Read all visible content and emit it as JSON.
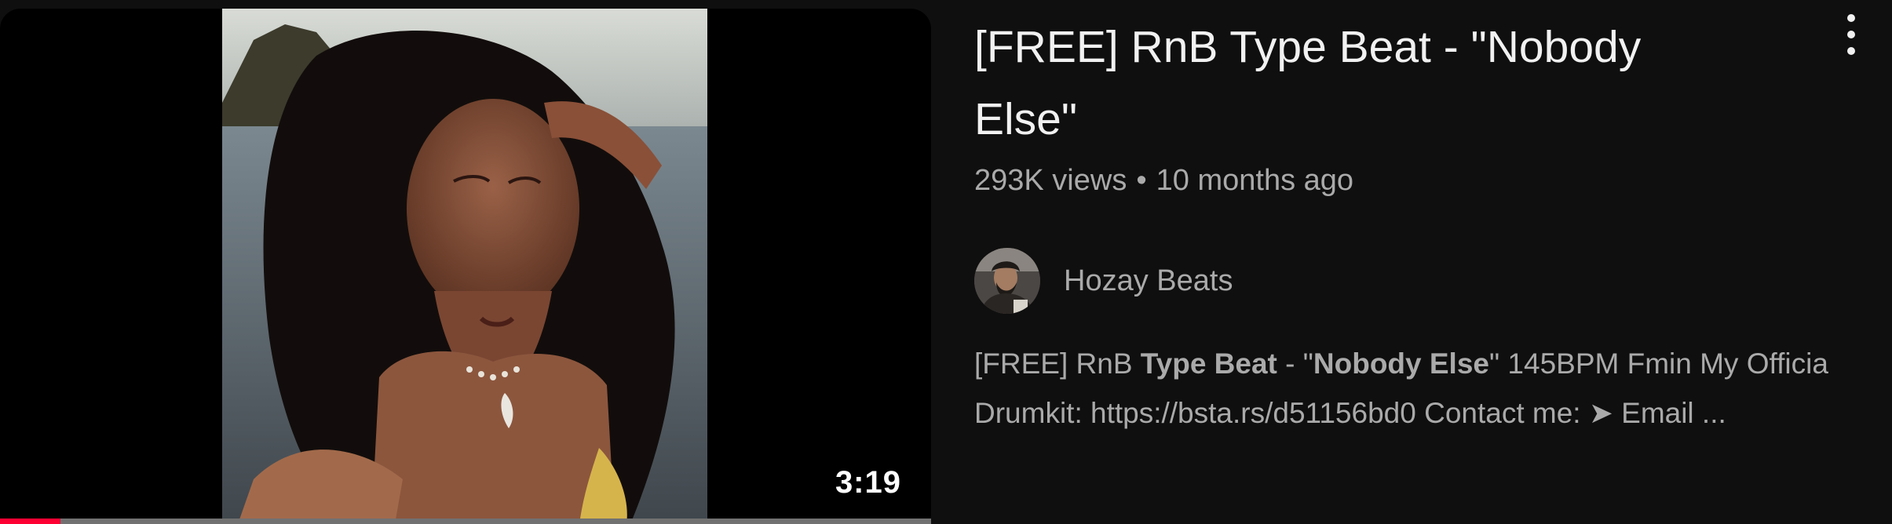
{
  "video": {
    "title": "[FREE] RnB Type Beat - \"Nobody Else\"",
    "views": "293K views",
    "separator": "•",
    "age": "10 months ago",
    "duration": "3:19",
    "watch_progress": 0.065,
    "channel": {
      "name": "Hozay Beats",
      "avatar_icon": "channel-avatar"
    },
    "description": {
      "seg1": "[FREE] RnB ",
      "seg2_bold": "Type Beat",
      "seg3": " - \"",
      "seg4_bold": "Nobody Else",
      "seg5": "\" 145BPM Fmin My Officia",
      "line2": "Drumkit: https://bsta.rs/d51156bd0 Contact me: ➤ Email ..."
    },
    "menu_icon": "more-vertical-icon"
  },
  "colors": {
    "background": "#0f0f0f",
    "title": "#f1f1f1",
    "secondary_text": "#aaaaaa",
    "progress": "#ff0033",
    "progress_track": "#717171"
  }
}
